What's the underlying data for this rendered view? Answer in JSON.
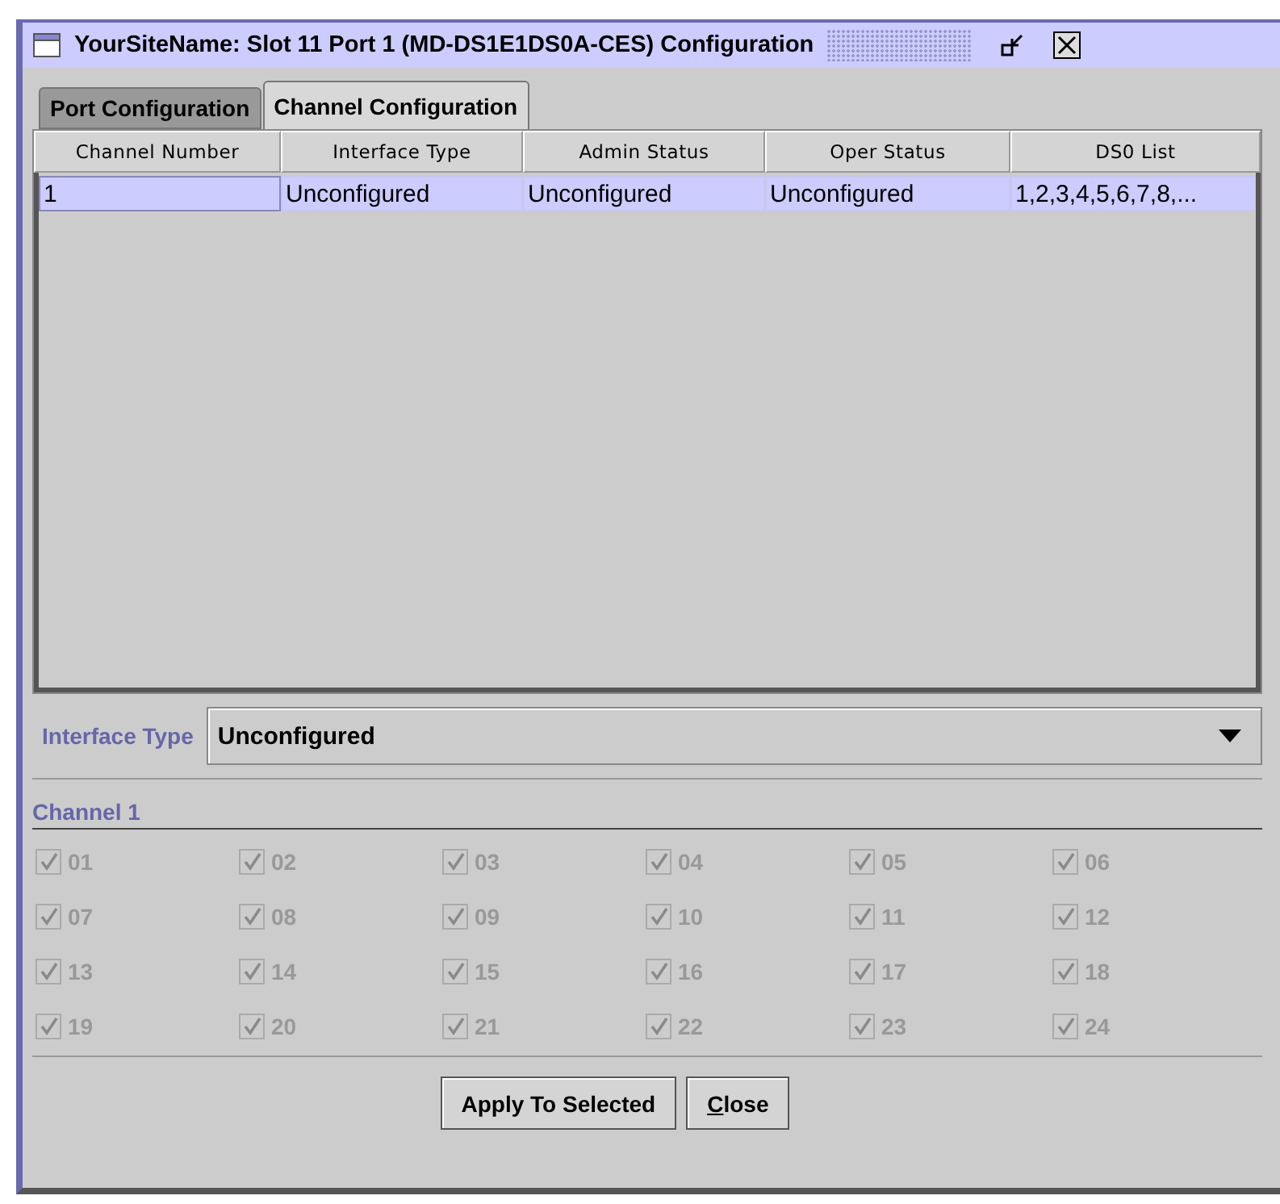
{
  "window": {
    "title": "YourSiteName: Slot 11 Port 1 (MD-DS1E1DS0A-CES) Configuration"
  },
  "tabs": [
    {
      "label": "Port Configuration",
      "selected": false
    },
    {
      "label": "Channel Configuration",
      "selected": true
    }
  ],
  "table": {
    "columns": [
      "Channel Number",
      "Interface Type",
      "Admin Status",
      "Oper Status",
      "DS0 List"
    ],
    "rows": [
      {
        "selected": true,
        "cells": [
          "1",
          "Unconfigured",
          "Unconfigured",
          "Unconfigured",
          "1,2,3,4,5,6,7,8,..."
        ]
      }
    ]
  },
  "interface_type": {
    "label": "Interface Type",
    "value": "Unconfigured"
  },
  "channel": {
    "title": "Channel 1",
    "ds0s": [
      {
        "label": "01",
        "checked": true,
        "disabled": true
      },
      {
        "label": "02",
        "checked": true,
        "disabled": true
      },
      {
        "label": "03",
        "checked": true,
        "disabled": true
      },
      {
        "label": "04",
        "checked": true,
        "disabled": true
      },
      {
        "label": "05",
        "checked": true,
        "disabled": true
      },
      {
        "label": "06",
        "checked": true,
        "disabled": true
      },
      {
        "label": "07",
        "checked": true,
        "disabled": true
      },
      {
        "label": "08",
        "checked": true,
        "disabled": true
      },
      {
        "label": "09",
        "checked": true,
        "disabled": true
      },
      {
        "label": "10",
        "checked": true,
        "disabled": true
      },
      {
        "label": "11",
        "checked": true,
        "disabled": true
      },
      {
        "label": "12",
        "checked": true,
        "disabled": true
      },
      {
        "label": "13",
        "checked": true,
        "disabled": true
      },
      {
        "label": "14",
        "checked": true,
        "disabled": true
      },
      {
        "label": "15",
        "checked": true,
        "disabled": true
      },
      {
        "label": "16",
        "checked": true,
        "disabled": true
      },
      {
        "label": "17",
        "checked": true,
        "disabled": true
      },
      {
        "label": "18",
        "checked": true,
        "disabled": true
      },
      {
        "label": "19",
        "checked": true,
        "disabled": true
      },
      {
        "label": "20",
        "checked": true,
        "disabled": true
      },
      {
        "label": "21",
        "checked": true,
        "disabled": true
      },
      {
        "label": "22",
        "checked": true,
        "disabled": true
      },
      {
        "label": "23",
        "checked": true,
        "disabled": true
      },
      {
        "label": "24",
        "checked": true,
        "disabled": true
      }
    ]
  },
  "buttons": [
    {
      "label": "Apply To Selected",
      "mnemonic": false
    },
    {
      "label": "Close",
      "mnemonic": true
    }
  ]
}
